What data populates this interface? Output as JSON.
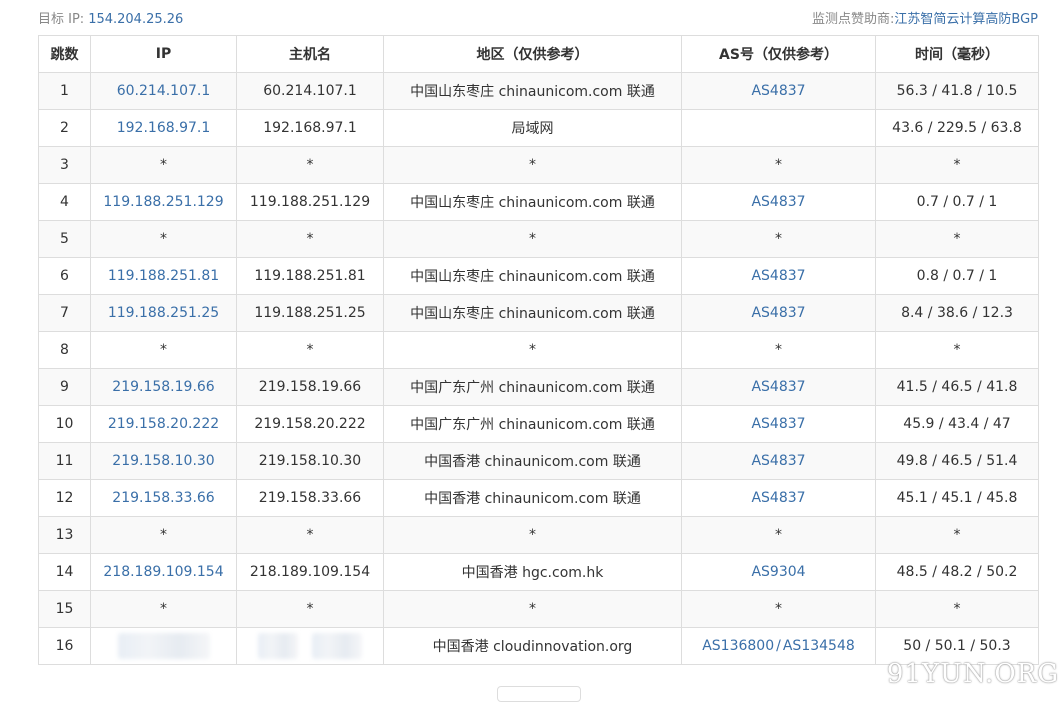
{
  "header": {
    "target_label": "目标 IP:",
    "target_ip": "154.204.25.26",
    "sponsor_label": "监测点赞助商:",
    "sponsor_name": "江苏智简云计算高防BGP"
  },
  "table": {
    "columns": [
      "跳数",
      "IP",
      "主机名",
      "地区（仅供参考）",
      "AS号（仅供参考）",
      "时间（毫秒）"
    ],
    "rows": [
      {
        "hop": "1",
        "ip": "60.214.107.1",
        "host": "60.214.107.1",
        "region": "中国山东枣庄 chinaunicom.com 联通",
        "as": [
          "AS4837"
        ],
        "time": "56.3 / 41.8 / 10.5"
      },
      {
        "hop": "2",
        "ip": "192.168.97.1",
        "host": "192.168.97.1",
        "region": "局域网",
        "as": [],
        "time": "43.6 / 229.5 / 63.8"
      },
      {
        "hop": "3",
        "ip": "*",
        "host": "*",
        "region": "*",
        "as_text": "*",
        "time": "*"
      },
      {
        "hop": "4",
        "ip": "119.188.251.129",
        "host": "119.188.251.129",
        "region": "中国山东枣庄 chinaunicom.com 联通",
        "as": [
          "AS4837"
        ],
        "time": "0.7 / 0.7 / 1"
      },
      {
        "hop": "5",
        "ip": "*",
        "host": "*",
        "region": "*",
        "as_text": "*",
        "time": "*"
      },
      {
        "hop": "6",
        "ip": "119.188.251.81",
        "host": "119.188.251.81",
        "region": "中国山东枣庄 chinaunicom.com 联通",
        "as": [
          "AS4837"
        ],
        "time": "0.8 / 0.7 / 1"
      },
      {
        "hop": "7",
        "ip": "119.188.251.25",
        "host": "119.188.251.25",
        "region": "中国山东枣庄 chinaunicom.com 联通",
        "as": [
          "AS4837"
        ],
        "time": "8.4 / 38.6 / 12.3"
      },
      {
        "hop": "8",
        "ip": "*",
        "host": "*",
        "region": "*",
        "as_text": "*",
        "time": "*"
      },
      {
        "hop": "9",
        "ip": "219.158.19.66",
        "host": "219.158.19.66",
        "region": "中国广东广州 chinaunicom.com 联通",
        "as": [
          "AS4837"
        ],
        "time": "41.5 / 46.5 / 41.8"
      },
      {
        "hop": "10",
        "ip": "219.158.20.222",
        "host": "219.158.20.222",
        "region": "中国广东广州 chinaunicom.com 联通",
        "as": [
          "AS4837"
        ],
        "time": "45.9 / 43.4 / 47"
      },
      {
        "hop": "11",
        "ip": "219.158.10.30",
        "host": "219.158.10.30",
        "region": "中国香港 chinaunicom.com 联通",
        "as": [
          "AS4837"
        ],
        "time": "49.8 / 46.5 / 51.4"
      },
      {
        "hop": "12",
        "ip": "219.158.33.66",
        "host": "219.158.33.66",
        "region": "中国香港 chinaunicom.com 联通",
        "as": [
          "AS4837"
        ],
        "time": "45.1 / 45.1 / 45.8"
      },
      {
        "hop": "13",
        "ip": "*",
        "host": "*",
        "region": "*",
        "as_text": "*",
        "time": "*"
      },
      {
        "hop": "14",
        "ip": "218.189.109.154",
        "host": "218.189.109.154",
        "region": "中国香港 hgc.com.hk",
        "as": [
          "AS9304"
        ],
        "time": "48.5 / 48.2 / 50.2"
      },
      {
        "hop": "15",
        "ip": "*",
        "host": "*",
        "region": "*",
        "as_text": "*",
        "time": "*"
      },
      {
        "hop": "16",
        "ip": "",
        "host": "",
        "ip_redacted": true,
        "region": "中国香港 cloudinnovation.org",
        "as": [
          "AS136800",
          "AS134548"
        ],
        "time": "50 / 50.1 / 50.3"
      }
    ]
  },
  "as_separator": "/",
  "watermark": "91YUN.ORG",
  "colors": {
    "link": "#3a6fa8",
    "border": "#dddddd",
    "stripe": "#f9f9f9",
    "muted": "#888888"
  }
}
